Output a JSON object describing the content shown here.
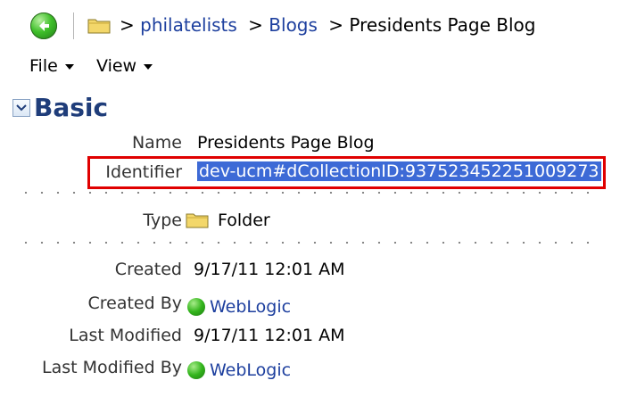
{
  "breadcrumb": {
    "separator": ">",
    "items": [
      "philatelists",
      "Blogs",
      "Presidents Page Blog"
    ]
  },
  "menu": {
    "file_label": "File",
    "view_label": "View"
  },
  "section": {
    "title": "Basic"
  },
  "properties": {
    "name_label": "Name",
    "name_value": "Presidents Page Blog",
    "identifier_label": "Identifier",
    "identifier_value": "dev-ucm#dCollectionID:937523452251009273",
    "type_label": "Type",
    "type_value": "Folder",
    "created_label": "Created",
    "created_value": "9/17/11 12:01 AM",
    "created_by_label": "Created By",
    "created_by_value": "WebLogic",
    "last_modified_label": "Last Modified",
    "last_modified_value": "9/17/11 12:01 AM",
    "last_modified_by_label": "Last Modified By",
    "last_modified_by_value": "WebLogic"
  },
  "colors": {
    "link": "#1d3f9e",
    "selection": "#3d6ad6",
    "highlight_border": "#e00000",
    "status_online": "#33b51c"
  },
  "icons": {
    "back": "back-arrow-icon",
    "folder": "folder-icon",
    "user_status": "user-online-icon"
  }
}
